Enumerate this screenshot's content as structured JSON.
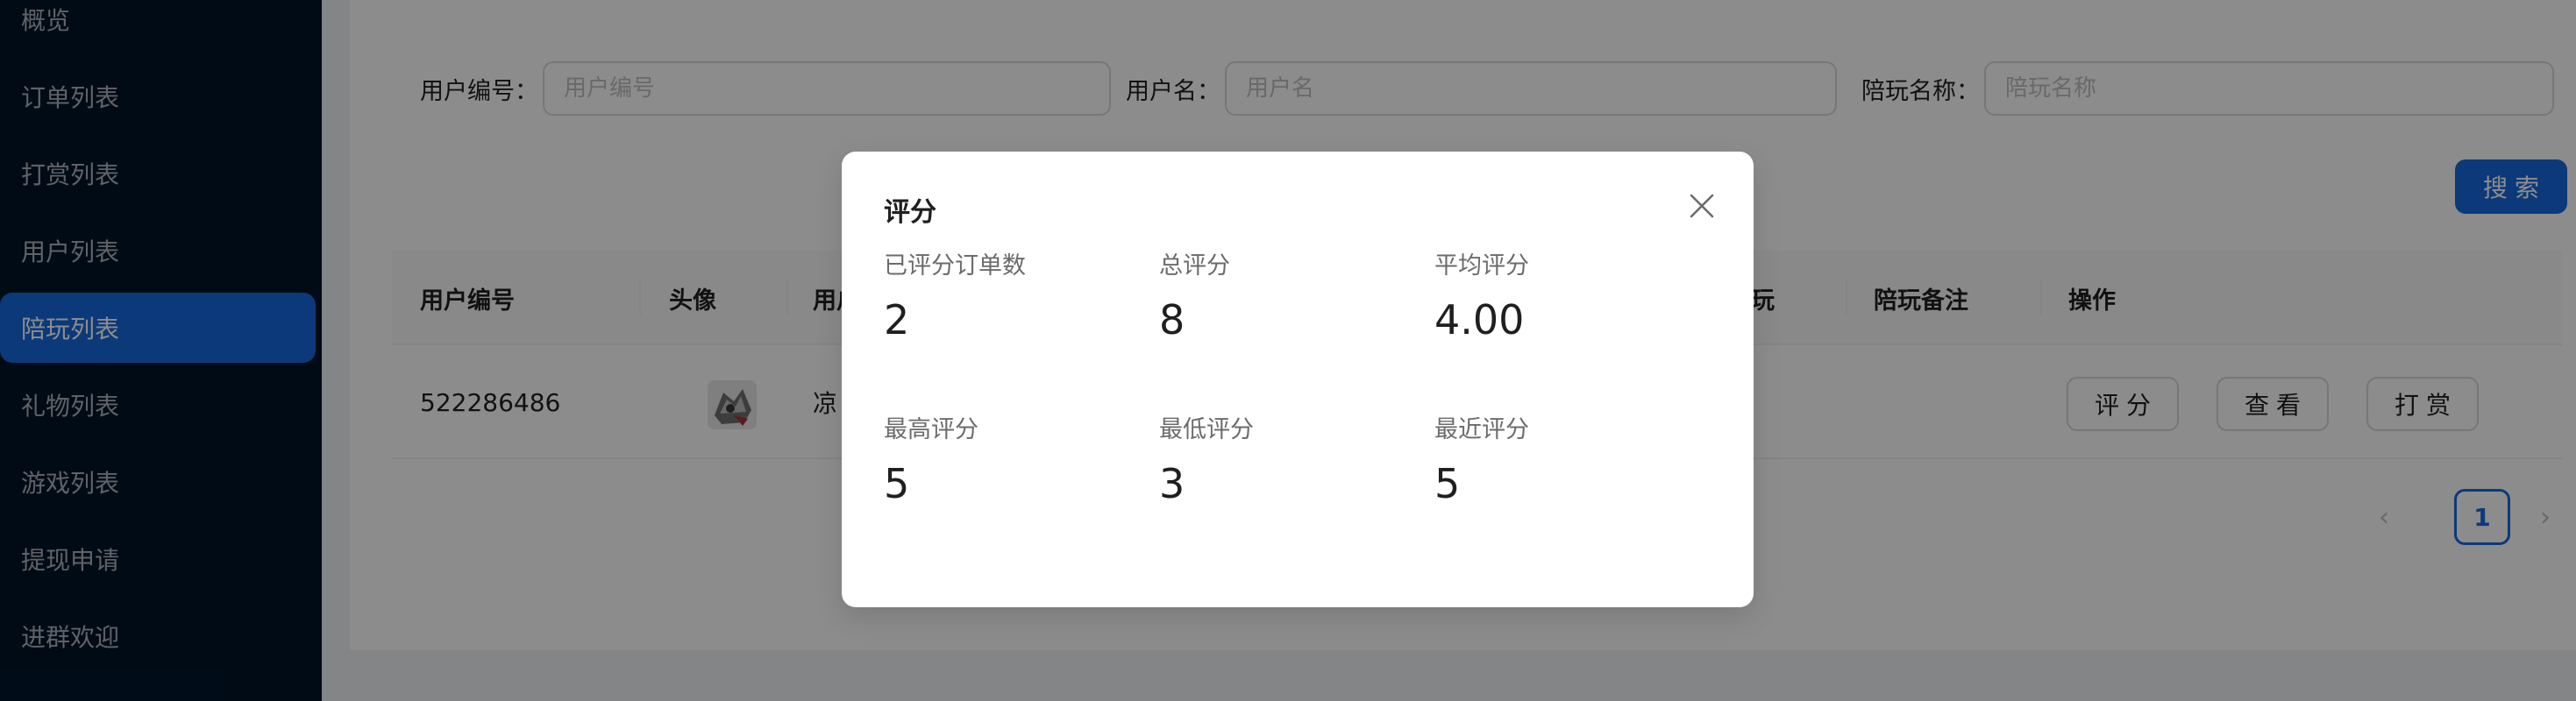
{
  "sidebar": {
    "items": [
      {
        "label": "概览"
      },
      {
        "label": "订单列表"
      },
      {
        "label": "打赏列表"
      },
      {
        "label": "用户列表"
      },
      {
        "label": "陪玩列表",
        "active": true
      },
      {
        "label": "礼物列表"
      },
      {
        "label": "游戏列表"
      },
      {
        "label": "提现申请"
      },
      {
        "label": "进群欢迎"
      }
    ]
  },
  "search": {
    "user_id_label": "用户编号：",
    "user_id_placeholder": "用户编号",
    "username_label": "用户名：",
    "username_placeholder": "用户名",
    "companion_name_label": "陪玩名称：",
    "companion_name_placeholder": "陪玩名称",
    "search_button": "搜索"
  },
  "table": {
    "columns": {
      "user_id": "用户编号",
      "avatar": "头像",
      "username": "用户",
      "companion": "玩",
      "companion_note": "陪玩备注",
      "actions": "操作"
    },
    "rows": [
      {
        "user_id": "522286486",
        "username": "凉",
        "actions": {
          "rate": "评分",
          "view": "查看",
          "tip": "打赏"
        }
      }
    ]
  },
  "pagination": {
    "current_page": "1"
  },
  "modal": {
    "title": "评分",
    "stats": [
      {
        "label": "已评分订单数",
        "value": "2"
      },
      {
        "label": "总评分",
        "value": "8"
      },
      {
        "label": "平均评分",
        "value": "4.00"
      },
      {
        "label": "最高评分",
        "value": "5"
      },
      {
        "label": "最低评分",
        "value": "3"
      },
      {
        "label": "最近评分",
        "value": "5"
      }
    ]
  },
  "colors": {
    "primary": "#1668dc",
    "sidebar_bg": "#001529",
    "mask": "rgba(0,0,0,0.45)"
  }
}
